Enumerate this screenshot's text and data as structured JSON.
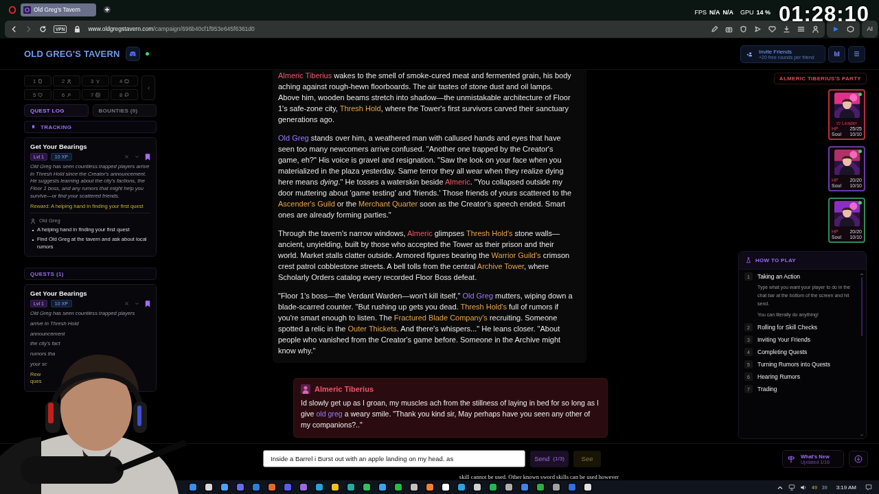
{
  "browser": {
    "tab_title": "Old Greg's Tavern",
    "url_host": "www.oldgregstavern.com",
    "url_path": "/campaign/696b40cf1f953e645f6361d0",
    "vpn_badge": "VPN",
    "ai_button": "AI"
  },
  "stream_overlay": {
    "stats": [
      {
        "label": "FPS",
        "values": [
          "N/A",
          "N/A"
        ]
      },
      {
        "label": "GPU",
        "values": [
          "14 %"
        ]
      }
    ],
    "timer": "01:28:10",
    "caption": "skill cannot be used. Other known sword skills can be used however"
  },
  "header": {
    "title": "OLD GREG'S TAVERN",
    "online": true,
    "invite": {
      "label": "Invite Friends",
      "sub": "+20 free rounds per friend"
    }
  },
  "hotkeys": [
    "1",
    "2",
    "3",
    "4",
    "5",
    "6",
    "7",
    "8"
  ],
  "sidebar_tabs": [
    {
      "label": "QUEST LOG",
      "selected": true
    },
    {
      "label": "BOUNTIES (0)",
      "selected": false
    }
  ],
  "tracking": {
    "label": "TRACKING",
    "quest": {
      "title": "Get Your Bearings",
      "level": "Lvl 1",
      "xp": "10 XP",
      "tracked": true,
      "description": "Old Greg has seen countless trapped players arrive in Thresh Hold since the Creator's announcement. He suggests learning about the city's factions, the Floor 1 boss, and any rumors that might help you survive—or find your scattered friends.",
      "reward": "Reward: A helping hand in finding your first quest",
      "giver": "Old Greg",
      "objectives": [
        "A helping hand in finding your first quest",
        "Find Old Greg at the tavern and ask about local rumors"
      ]
    }
  },
  "quests": {
    "label": "QUESTS (1)",
    "items": [
      {
        "title": "Get Your Bearings",
        "level": "Lvl 1",
        "xp": "10 XP",
        "tracked": true,
        "description_lines": [
          "Old Greg has seen countless trapped players",
          "arrive in Thresh Hold",
          "announcement",
          "the city's fact",
          "rumors tha",
          "your sc"
        ],
        "reward_lines": [
          "Rew",
          "ques"
        ]
      }
    ]
  },
  "narrative": [
    {
      "segments": [
        {
          "text": "Almeric Tiberius",
          "kind": "player"
        },
        {
          "text": " wakes to the smell of smoke-cured meat and fermented grain, his body aching against rough-hewn floorboards. The air tastes of stone dust and oil lamps. Above him, wooden beams stretch into shadow—the unmistakable architecture of Floor 1's safe-zone city, "
        },
        {
          "text": "Thresh Hold",
          "kind": "place"
        },
        {
          "text": ", where the Tower's first survivors carved their sanctuary generations ago."
        }
      ]
    },
    {
      "segments": [
        {
          "text": "Old Greg",
          "kind": "npc"
        },
        {
          "text": " stands over him, a weathered man with callused hands and eyes that have seen too many newcomers arrive confused. \"Another one trapped by the Creator's game, eh?\" His voice is gravel and resignation. \"Saw the look on your face when you materialized in the plaza yesterday. Same terror they all wear when they realize dying here means "
        },
        {
          "text": "dying",
          "kind": "italic"
        },
        {
          "text": ".\" He tosses a waterskin beside "
        },
        {
          "text": "Almeric",
          "kind": "player"
        },
        {
          "text": ". \"You collapsed outside my door muttering about 'game testing' and 'friends.' Those friends of yours scattered to the "
        },
        {
          "text": "Ascender's Guild",
          "kind": "place"
        },
        {
          "text": " or the "
        },
        {
          "text": "Merchant Quarter",
          "kind": "place"
        },
        {
          "text": " soon as the Creator's speech ended. Smart ones are already forming parties.\""
        }
      ]
    },
    {
      "segments": [
        {
          "text": "Through the tavern's narrow windows, "
        },
        {
          "text": "Almeric",
          "kind": "player"
        },
        {
          "text": " glimpses "
        },
        {
          "text": "Thresh Hold's",
          "kind": "place"
        },
        {
          "text": " stone walls—ancient, unyielding, built by those who accepted the Tower as their prison and their world. Market stalls clatter outside. Armored figures bearing the "
        },
        {
          "text": "Warrior Guild's",
          "kind": "place"
        },
        {
          "text": " crimson crest patrol cobblestone streets. A bell tolls from the central "
        },
        {
          "text": "Archive Tower",
          "kind": "place"
        },
        {
          "text": ", where Scholarly Orders catalog every recorded Floor Boss defeat."
        }
      ]
    },
    {
      "segments": [
        {
          "text": "\"Floor 1's boss—the Verdant Warden—won't kill itself,\" "
        },
        {
          "text": "Old Greg",
          "kind": "npc"
        },
        {
          "text": " mutters, wiping down a blade-scarred counter. \"But rushing up gets you dead. "
        },
        {
          "text": "Thresh Hold's",
          "kind": "place"
        },
        {
          "text": " full of rumors if you're smart enough to listen. The "
        },
        {
          "text": "Fractured Blade Company's",
          "kind": "place"
        },
        {
          "text": " recruiting. Someone spotted a relic in the "
        },
        {
          "text": "Outer Thickets",
          "kind": "place"
        },
        {
          "text": ". And there's whispers...\" He leans closer. \"About people who vanished from the Creator's game before. Someone in the Archive might know why.\""
        }
      ]
    }
  ],
  "player_message": {
    "author": "Almeric Tiberius",
    "segments": [
      {
        "text": "Id slowly get up as I groan, my muscles ach from the stillness of laying in bed for so long as I give "
      },
      {
        "text": "old greg",
        "kind": "npc"
      },
      {
        "text": " a weary smile. \"Thank you kind sir, May perhaps have you seen any other of my companions?..\""
      }
    ]
  },
  "composer": {
    "value": "Inside a Barrel i Burst out with an apple landing on my head. as",
    "send": "Send",
    "send_count": "(1/3)",
    "see": "See"
  },
  "party": {
    "title": "ALMERIC TIBERIUS'S PARTY",
    "members": [
      {
        "color": "#b8303e",
        "online": true,
        "leader": true,
        "leader_label": "Leader",
        "stats": [
          {
            "label": "HP",
            "value": "25/25"
          },
          {
            "label": "Soul",
            "value": "10/10"
          }
        ]
      },
      {
        "color": "#6b3aa6",
        "online": true,
        "leader": false,
        "stats": [
          {
            "label": "HP",
            "value": "20/20"
          },
          {
            "label": "Soul",
            "value": "10/10"
          }
        ]
      },
      {
        "color": "#2f8a5c",
        "online": true,
        "leader": false,
        "stats": [
          {
            "label": "HP",
            "value": "20/20"
          },
          {
            "label": "Soul",
            "value": "10/10"
          }
        ]
      }
    ]
  },
  "how_to_play": {
    "title": "HOW TO PLAY",
    "steps": [
      {
        "number": "1",
        "title": "Taking an Action",
        "expanded": true,
        "body": [
          "Type what you want your player to do in the chat bar at the bottom of the screen and hit send.",
          "You can literally do anything!"
        ]
      },
      {
        "number": "2",
        "title": "Rolling for Skill Checks",
        "expanded": false
      },
      {
        "number": "3",
        "title": "Inviting Your Friends",
        "expanded": false
      },
      {
        "number": "4",
        "title": "Completing Quests",
        "expanded": false
      },
      {
        "number": "5",
        "title": "Turning Rumors into Quests",
        "expanded": false
      },
      {
        "number": "6",
        "title": "Hearing Rumors",
        "expanded": false
      },
      {
        "number": "7",
        "title": "Trading",
        "expanded": false
      }
    ]
  },
  "whats_new": {
    "label": "What's New",
    "sub": "Updated 1/16"
  },
  "taskbar": {
    "tray": [
      "49",
      "39"
    ],
    "clock": "3:19 AM"
  }
}
